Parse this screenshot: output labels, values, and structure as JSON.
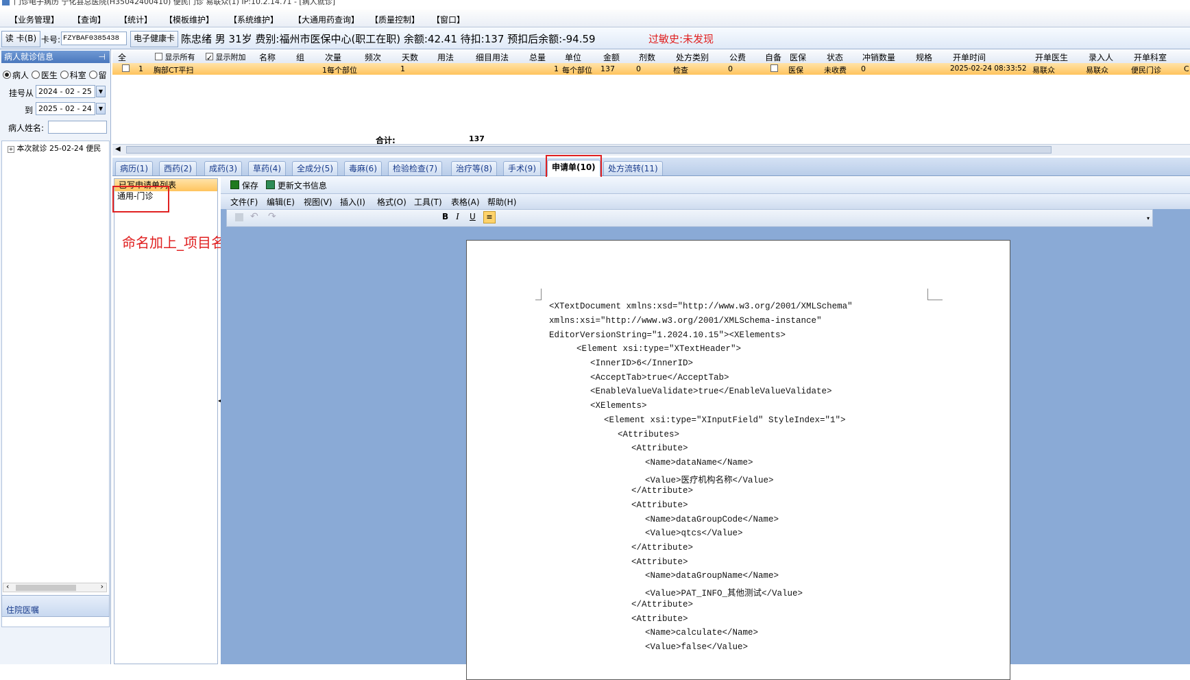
{
  "window": {
    "title": "门诊电子病历  宁化县总医院(H35042400410)  便民门诊  易联众(1) IP:10.2.14.71 - [病人就诊]"
  },
  "menubar": [
    "【业务管理】",
    "【查询】",
    "【统计】",
    "【模板维护】",
    "【系统维护】",
    "【大通用药查询】",
    "【质量控制】",
    "【窗口】"
  ],
  "infobar": {
    "read_card": "读 卡(B)",
    "card_label": "卡号:",
    "card_value": "FZYBAF0385438",
    "ehealth_button": "电子健康卡",
    "patient": "陈忠绪  男  31岁  费别:福州市医保中心(职工在职)  余额:42.41  待扣:137  预扣后余额:-94.59",
    "allergy": "过敏史:未发现"
  },
  "leftpanel": {
    "header": "病人就诊信息",
    "pin": "ꟼ",
    "radios": [
      "病人",
      "医生",
      "科室",
      "留"
    ],
    "from_label": "挂号从",
    "from_value": "2024 - 02 - 25",
    "to_label": "到",
    "to_value": "2025 - 02 - 24",
    "name_label": "病人姓名:",
    "tree_item": "本次就诊 25-02-24  便民",
    "bottom_header": "住院医嘱"
  },
  "grid": {
    "headers": [
      "全",
      "显示所有",
      "显示附加",
      "名称",
      "组",
      "次量",
      "频次",
      "天数",
      "用法",
      "细目用法",
      "总量",
      "单位",
      "金额",
      "剂数",
      "处方类别",
      "公费",
      "自备",
      "医保",
      "状态",
      "冲销数量",
      "规格",
      "开单时间",
      "开单医生",
      "录入人",
      "开单科室"
    ],
    "row": {
      "no": "1",
      "name": "胸部CT平扫",
      "qty": "1每个部位",
      "freq": "1",
      "total": "1",
      "unit": "每个部位",
      "amount": "137",
      "doses": "0",
      "category": "检查",
      "gongfei": "0",
      "yibao": "医保",
      "status": "未收费",
      "chongxiao": "0",
      "time": "2025-02-24 08:33:52",
      "doctor": "易联众",
      "entry": "易联众",
      "dept": "便民门诊",
      "extra": "C"
    },
    "total_label": "合计:",
    "total_value": "137"
  },
  "tabs": [
    "病历(1)",
    "西药(2)",
    "成药(3)",
    "草药(4)",
    "全成分(5)",
    "毒麻(6)",
    "检验检查(7)",
    "治疗等(8)",
    "手术(9)",
    "申请单(10)",
    "处方流转(11)"
  ],
  "sublist": {
    "header": "已写申请单列表",
    "item": "通用-门诊"
  },
  "annotation": "命名加上_项目名称",
  "editor": {
    "save": "保存",
    "update": "更新文书信息",
    "menu": [
      "文件(F)",
      "编辑(E)",
      "视图(V)",
      "插入(I)",
      "格式(O)",
      "工具(T)",
      "表格(A)",
      "帮助(H)"
    ],
    "bold": "B",
    "italic": "I",
    "underline": "U",
    "xml_lines": [
      "<XTextDocument xmlns:xsd=\"http://www.w3.org/2001/XMLSchema\"",
      "xmlns:xsi=\"http://www.w3.org/2001/XMLSchema-instance\"",
      "EditorVersionString=\"1.2024.10.15\"><XElements>",
      "<Element xsi:type=\"XTextHeader\">",
      "<InnerID>6</InnerID>",
      "<AcceptTab>true</AcceptTab>",
      "<EnableValueValidate>true</EnableValueValidate>",
      "<XElements>",
      "<Element xsi:type=\"XInputField\" StyleIndex=\"1\">",
      "<Attributes>",
      "<Attribute>",
      "<Name>dataName</Name>",
      "<Value>医疗机构名称</Value>",
      "</Attribute>",
      "<Attribute>",
      "<Name>dataGroupCode</Name>",
      "<Value>qtcs</Value>",
      "</Attribute>",
      "<Attribute>",
      "<Name>dataGroupName</Name>",
      "<Value>PAT_INFO_其他测试</Value>",
      "</Attribute>",
      "<Attribute>",
      "<Name>calculate</Name>",
      "<Value>false</Value>"
    ]
  },
  "colors": {
    "accent": "#4a78bd",
    "highlight_row": "#ffc45e",
    "annotation": "#e02020"
  }
}
